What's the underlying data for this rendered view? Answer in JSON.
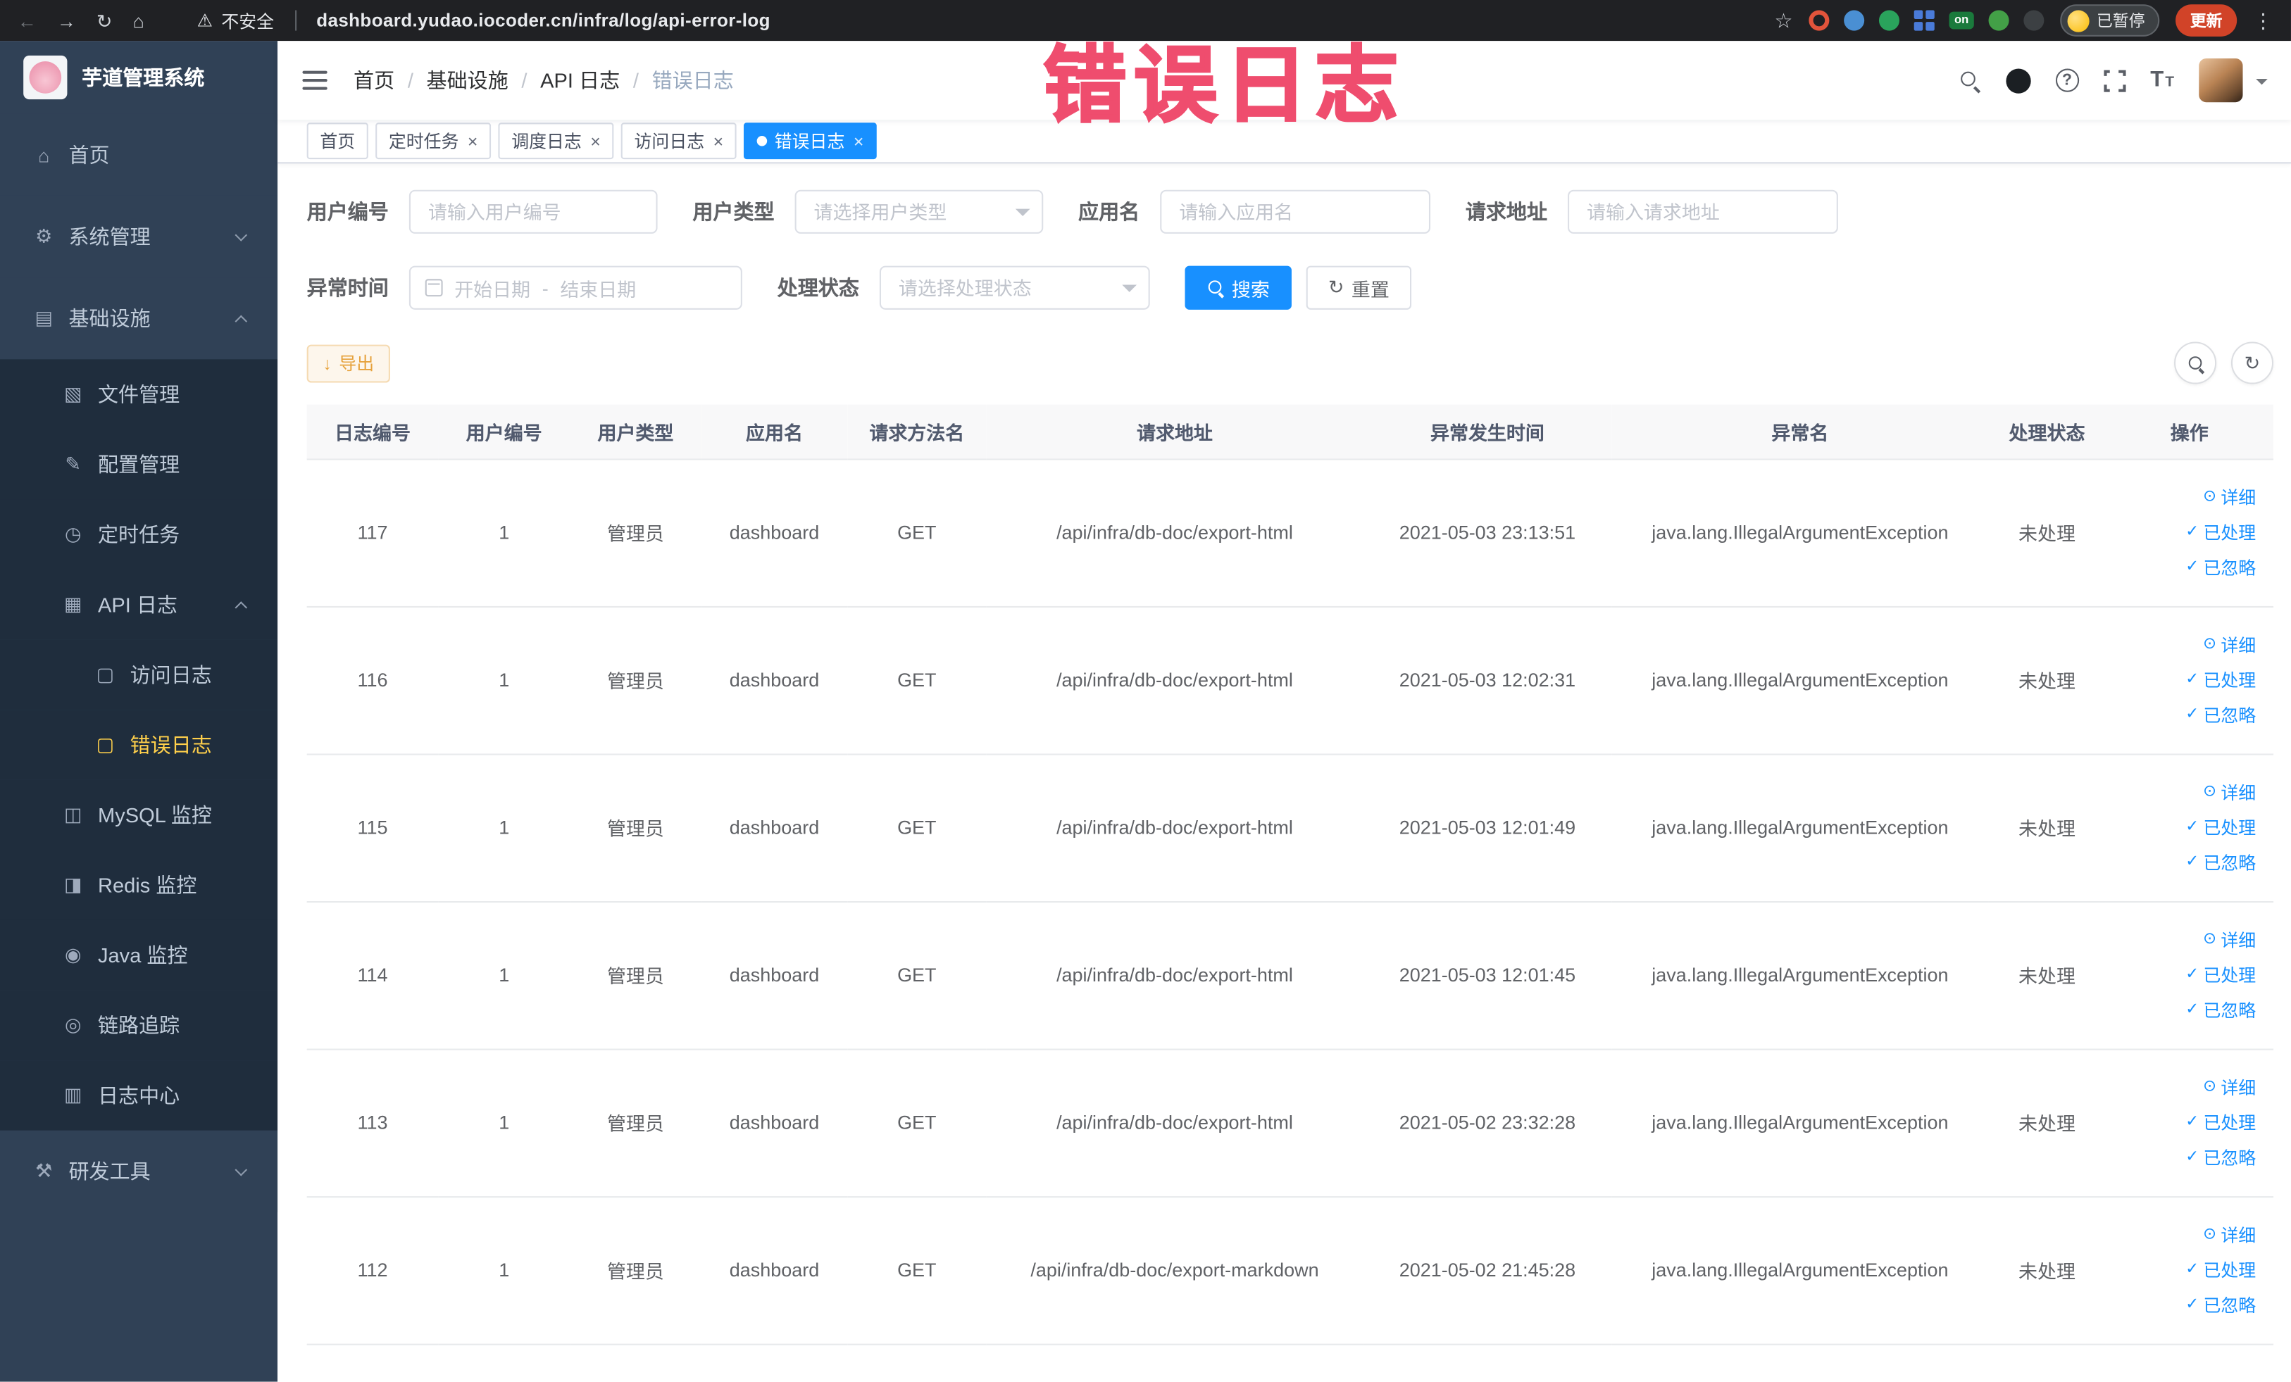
{
  "colors": {
    "primary": "#1890ff",
    "sidebar_bg": "#304156",
    "submenu_bg": "#1f2d3d",
    "menu_text": "#bfcbd9",
    "active_text": "#ffd04b",
    "watermark": "#ef4d6e",
    "update_badge": "#d14328"
  },
  "browser": {
    "security_label": "不安全",
    "url": "dashboard.yudao.iocoder.cn/infra/log/api-error-log",
    "extensions": [
      {
        "name": "extension-icon-orange-ring",
        "shape": "ring",
        "color": "#e2543b"
      },
      {
        "name": "extension-icon-blue-drop",
        "shape": "circle",
        "color": "#4a8fd3"
      },
      {
        "name": "extension-icon-green-circle",
        "shape": "circle",
        "color": "#2aa35c"
      },
      {
        "name": "extension-icon-blue-grid",
        "shape": "grid",
        "color": "#4a7bd9"
      },
      {
        "name": "extension-icon-on-badge",
        "shape": "badge",
        "color": "#1a7a3c",
        "label": "on"
      },
      {
        "name": "extension-icon-green-leaf",
        "shape": "circle",
        "color": "#43a047"
      },
      {
        "name": "extension-icon-dark-paw",
        "shape": "circle",
        "color": "#3c4043"
      }
    ],
    "profile_chip": {
      "label": "已暂停"
    },
    "update_button": {
      "label": "更新"
    }
  },
  "watermark": {
    "text": "错误日志"
  },
  "sidebar": {
    "logo_title": "芋道管理系统",
    "items": [
      {
        "id": "home",
        "label": "首页",
        "icon": "home-icon",
        "level": 0
      },
      {
        "id": "system-management",
        "label": "系统管理",
        "icon": "gear-icon",
        "level": 0,
        "arrow": "down"
      },
      {
        "id": "infrastructure",
        "label": "基础设施",
        "icon": "infra-icon",
        "level": 0,
        "arrow": "up"
      },
      {
        "id": "file-management",
        "label": "文件管理",
        "icon": "file-icon",
        "level": 1,
        "submenu": true
      },
      {
        "id": "config-management",
        "label": "配置管理",
        "icon": "config-icon",
        "level": 1,
        "submenu": true
      },
      {
        "id": "scheduled-tasks",
        "label": "定时任务",
        "icon": "timer-icon",
        "level": 1,
        "submenu": true
      },
      {
        "id": "api-log",
        "label": "API 日志",
        "icon": "api-log-icon",
        "level": 1,
        "submenu": true,
        "arrow": "up"
      },
      {
        "id": "access-log",
        "label": "访问日志",
        "icon": "access-log-icon",
        "level": 2,
        "submenu": true
      },
      {
        "id": "error-log",
        "label": "错误日志",
        "icon": "error-log-icon",
        "level": 2,
        "submenu": true,
        "active": true
      },
      {
        "id": "mysql-monitor",
        "label": "MySQL 监控",
        "icon": "mysql-icon",
        "level": 1,
        "submenu": true
      },
      {
        "id": "redis-monitor",
        "label": "Redis 监控",
        "icon": "redis-icon",
        "level": 1,
        "submenu": true
      },
      {
        "id": "java-monitor",
        "label": "Java 监控",
        "icon": "java-icon",
        "level": 1,
        "submenu": true
      },
      {
        "id": "trace",
        "label": "链路追踪",
        "icon": "trace-icon",
        "level": 1,
        "submenu": true
      },
      {
        "id": "log-center",
        "label": "日志中心",
        "icon": "log-center-icon",
        "level": 1,
        "submenu": true
      },
      {
        "id": "dev-tools",
        "label": "研发工具",
        "icon": "tools-icon",
        "level": 0,
        "arrow": "down"
      }
    ]
  },
  "header": {
    "breadcrumb": [
      "首页",
      "基础设施",
      "API 日志",
      "错误日志"
    ]
  },
  "tabs": [
    {
      "label": "首页",
      "closable": false,
      "active": false
    },
    {
      "label": "定时任务",
      "closable": true,
      "active": false
    },
    {
      "label": "调度日志",
      "closable": true,
      "active": false
    },
    {
      "label": "访问日志",
      "closable": true,
      "active": false
    },
    {
      "label": "错误日志",
      "closable": true,
      "active": true
    }
  ],
  "filters": {
    "user_id": {
      "label": "用户编号",
      "placeholder": "请输入用户编号"
    },
    "user_type": {
      "label": "用户类型",
      "placeholder": "请选择用户类型"
    },
    "app_name": {
      "label": "应用名",
      "placeholder": "请输入应用名"
    },
    "request_url": {
      "label": "请求地址",
      "placeholder": "请输入请求地址"
    },
    "error_time": {
      "label": "异常时间",
      "start_placeholder": "开始日期",
      "separator": "-",
      "end_placeholder": "结束日期"
    },
    "process_status": {
      "label": "处理状态",
      "placeholder": "请选择处理状态"
    },
    "search_label": "搜索",
    "reset_label": "重置"
  },
  "toolbar": {
    "export_label": "导出"
  },
  "table": {
    "columns": [
      "日志编号",
      "用户编号",
      "用户类型",
      "应用名",
      "请求方法名",
      "请求地址",
      "异常发生时间",
      "异常名",
      "处理状态",
      "操作"
    ],
    "actions": [
      {
        "name": "detail",
        "label": "详细",
        "icon": "view-icon"
      },
      {
        "name": "processed",
        "label": "已处理",
        "icon": "check-icon"
      },
      {
        "name": "ignored",
        "label": "已忽略",
        "icon": "check-icon"
      }
    ],
    "rows": [
      {
        "log_id": "117",
        "user_id": "1",
        "user_type": "管理员",
        "app_name": "dashboard",
        "method": "GET",
        "request_url": "/api/infra/db-doc/export-html",
        "error_time": "2021-05-03 23:13:51",
        "exception_name": "java.lang.IllegalArgumentException",
        "status": "未处理"
      },
      {
        "log_id": "116",
        "user_id": "1",
        "user_type": "管理员",
        "app_name": "dashboard",
        "method": "GET",
        "request_url": "/api/infra/db-doc/export-html",
        "error_time": "2021-05-03 12:02:31",
        "exception_name": "java.lang.IllegalArgumentException",
        "status": "未处理"
      },
      {
        "log_id": "115",
        "user_id": "1",
        "user_type": "管理员",
        "app_name": "dashboard",
        "method": "GET",
        "request_url": "/api/infra/db-doc/export-html",
        "error_time": "2021-05-03 12:01:49",
        "exception_name": "java.lang.IllegalArgumentException",
        "status": "未处理"
      },
      {
        "log_id": "114",
        "user_id": "1",
        "user_type": "管理员",
        "app_name": "dashboard",
        "method": "GET",
        "request_url": "/api/infra/db-doc/export-html",
        "error_time": "2021-05-03 12:01:45",
        "exception_name": "java.lang.IllegalArgumentException",
        "status": "未处理"
      },
      {
        "log_id": "113",
        "user_id": "1",
        "user_type": "管理员",
        "app_name": "dashboard",
        "method": "GET",
        "request_url": "/api/infra/db-doc/export-html",
        "error_time": "2021-05-02 23:32:28",
        "exception_name": "java.lang.IllegalArgumentException",
        "status": "未处理"
      },
      {
        "log_id": "112",
        "user_id": "1",
        "user_type": "管理员",
        "app_name": "dashboard",
        "method": "GET",
        "request_url": "/api/infra/db-doc/export-markdown",
        "error_time": "2021-05-02 21:45:28",
        "exception_name": "java.lang.IllegalArgumentException",
        "status": "未处理"
      }
    ]
  }
}
